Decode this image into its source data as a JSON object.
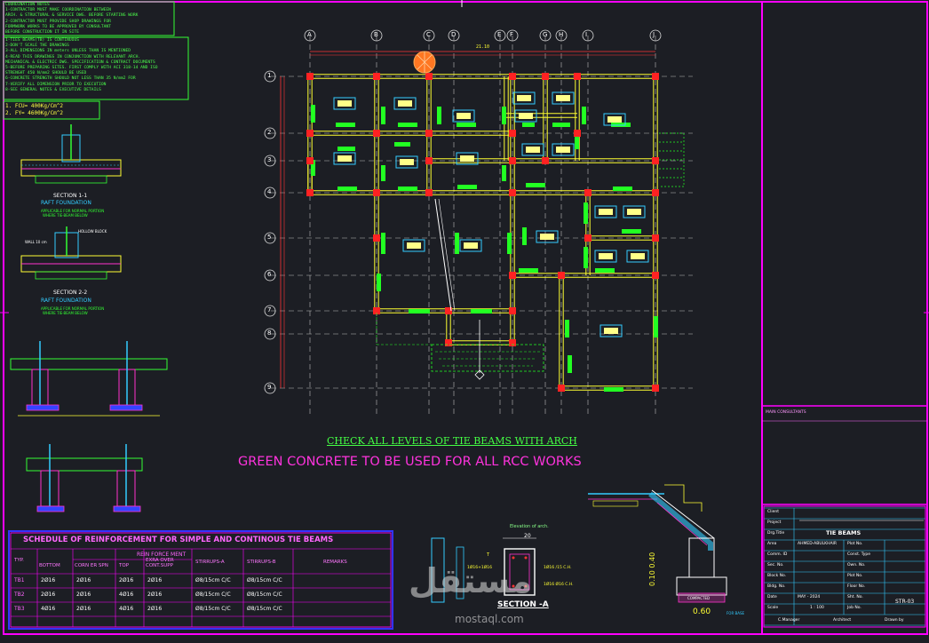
{
  "colors": {
    "background": "#1c1e24",
    "frame": "#ff00ff",
    "wall": "#ffff33",
    "column": "#ff2222",
    "beam": "#22ff22",
    "label": "#33ccff",
    "grid": "#cccccc"
  },
  "grid": {
    "columns": [
      "A",
      "B",
      "C",
      "D",
      "E",
      "F",
      "G",
      "H",
      "I",
      "J"
    ],
    "rows": [
      "1",
      "2",
      "3",
      "4",
      "5",
      "6",
      "7",
      "8",
      "9"
    ]
  },
  "notes": {
    "coord_title": "COORDINATION NOTES",
    "coord_lines": [
      "1-CONTRACTOR MUST MAKE COORDINATION BETWEEN",
      "ARCH. & STRUCTURAL & SERVICE DWG. BEFORE STARTING WORK",
      "2-CONTRACTOR MUST PROVIDE SHOP DRAWINGS FOR",
      "FORMWORK WORKS TO BE APPROVED BY CONSULTANT",
      "BEFORE CONSTRUCTION IT IN SITE"
    ],
    "general_lines": [
      "1-TIES BEAMS(TB) IS CONTINUOUS",
      "2-DON'T SCALE THE DRAWINGS",
      "3-ALL DIMENSIONS IN meters UNLESS THAN IS MENTIONED",
      "4-READ THIS DRAWINGS IN CONJUNCTION WITH RELEVANT ARCH.",
      "MECHANICAL & ELECTRIC DWG. SPECIFICATION & CONTRACT DOCUMENTS",
      "5-BEFORE PREPARING SITES. FIRST COMPLY WITH ACI 318-14 AND ISO",
      "STRENGHT 450 N/mm2 SHOULD BE USED",
      "6-CONCRETE STRENGTH SHOULD NOT LESS THAN 35 N/mm2 FOR",
      "7-VERIFY ALL DIMENSION PRIOR TO EXECUTION",
      "8-SEE GENERAL NOTES & EXECUTIVE DETAILS"
    ],
    "material_lines": [
      "1.  FCU= 400Kg/Cm^2",
      "2.  FY= 4600Kg/Cm^2"
    ]
  },
  "sections": {
    "s1_title": "SECTION 1-1",
    "s1_sub": "RAFT FOUNDATION",
    "s1_note1": "APPLICABLE FOR NORMAL PORTION",
    "s1_note2": "WHERE TIE-BEAM BELOW",
    "hollow_block": "HOLLOW BLOCK",
    "wall_label": "WALL 10 cm",
    "s2_title": "SECTION 2-2",
    "s2_sub": "RAFT FOUNDATION",
    "s2_note1": "APPLICABLE FOR NORMAL PORTION",
    "s2_note2": "WHERE TIE-BEAM BELOW"
  },
  "plan": {
    "top_dim": "21.10",
    "caption1": "CHECK ALL LEVELS OF TIE BEAMS WITH ARCH",
    "caption2": "GREEN CONCRETE TO BE USED FOR ALL RCC WORKS"
  },
  "schedule": {
    "title": "SCHEDULE OF REINFORCEMENT FOR SIMPLE AND CONTINOUS TIE BEAMS",
    "group_header": "REIN FORCE MENT",
    "headers": [
      "TYP.",
      "BOTTOM",
      "CORN ER SPN",
      "TOP",
      "EXRA OVER CONT.SUPP",
      "STIRRUPS-A",
      "STIRRUPS-B",
      "REMARKS"
    ],
    "rows": [
      [
        "TB1",
        "2Ø16",
        "2Ø16",
        "2Ø16",
        "2Ø16",
        "Ø8/15cm C/C",
        "Ø8/15cm C/C",
        ""
      ],
      [
        "TB2",
        "2Ø16",
        "2Ø16",
        "4Ø16",
        "2Ø16",
        "Ø8/15cm C/C",
        "Ø8/15cm C/C",
        ""
      ],
      [
        "TB3",
        "4Ø16",
        "2Ø16",
        "4Ø16",
        "2Ø16",
        "Ø8/15cm C/C",
        "Ø8/15cm C/C",
        ""
      ]
    ]
  },
  "section_a": {
    "title": "SECTION -A",
    "elev_label": "Elevation of arch.",
    "dim_20": "20",
    "bars1": "1Ø16+1Ø16",
    "bars2": "1Ø16 /15 C.H.",
    "bars3": "1Ø16 Ø16 C.H.",
    "tag": "T"
  },
  "stair_detail": {
    "dim_label": "0.10 0.40",
    "base_dim": "0.60",
    "compacted": "COMPACTED",
    "base_note": "FOR BASE"
  },
  "title_block": {
    "consultants": "MAIN CONSULTANTS",
    "client": "Client",
    "project": "Project",
    "drawing_title_label": "Drg.Title",
    "drawing_title": "TIE BEAMS",
    "area_label": "Area",
    "area_value": "AHMED-ABULKHAIR",
    "plot_no": "Plot No.",
    "comm_id": "Comm. ID",
    "const_type": "Const. Type",
    "sec_no": "Sec. No.",
    "own_no": "Own. No.",
    "block_no": "Block No.",
    "plot_no2": "Plot No.",
    "bldg_no": "Bldg. No.",
    "floor_no": "Floor No.",
    "date_label": "Date",
    "date_value": "MAY - 2024",
    "sht_no": "Sht. No.",
    "drawing_no": "STR-03",
    "scale_label": "Scale",
    "scale_value": "1 : 100",
    "job_no": "Job No.",
    "sign1": "C.Manager",
    "sign2": "Architect",
    "sign3": "Drawn by"
  },
  "watermark": {
    "arabic": "مستقل",
    "latin": "mostaql.com"
  }
}
